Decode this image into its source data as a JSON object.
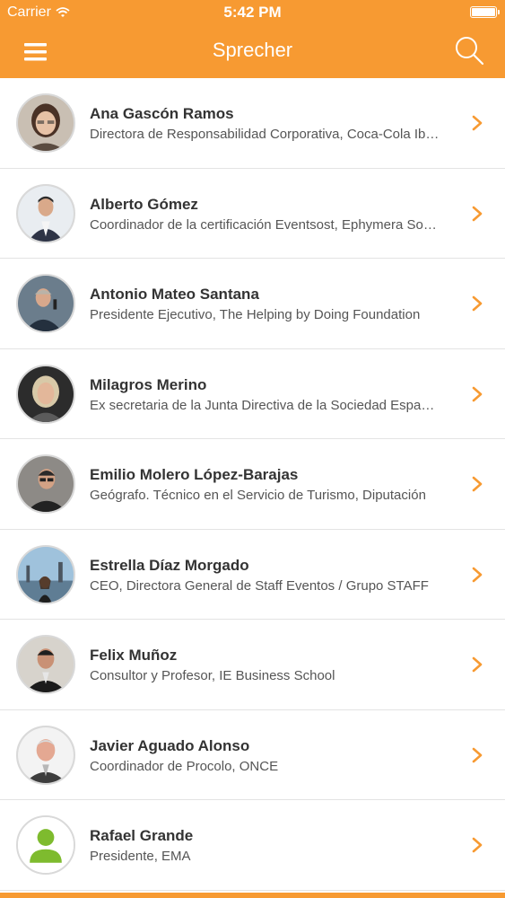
{
  "status_bar": {
    "carrier": "Carrier",
    "time": "5:42 PM"
  },
  "nav": {
    "title": "Sprecher",
    "menu_icon": "hamburger-icon",
    "search_icon": "search-icon"
  },
  "colors": {
    "accent": "#f79a32",
    "chevron": "#f79a32",
    "divider": "#e3e3e3"
  },
  "speakers": [
    {
      "name": "Ana Gascón Ramos",
      "role": "Directora de Responsabilidad Corporativa, Coca-Cola Iberia"
    },
    {
      "name": "Alberto Gómez",
      "role": "Coordinador de la certificación Eventsost, Ephymera Sostenibilidad"
    },
    {
      "name": "Antonio Mateo Santana",
      "role": "Presidente Ejecutivo, The Helping by Doing Foundation"
    },
    {
      "name": "Milagros Merino",
      "role": "Ex secretaria de la Junta Directiva de la Sociedad Española"
    },
    {
      "name": "Emilio Molero López-Barajas",
      "role": "Geógrafo. Técnico en el Servicio de Turismo, Diputación"
    },
    {
      "name": "Estrella Díaz Morgado",
      "role": "CEO, Directora General de Staff Eventos / Grupo STAFF"
    },
    {
      "name": "Felix Muñoz",
      "role": "Consultor y Profesor, IE Business School"
    },
    {
      "name": "Javier Aguado Alonso",
      "role": "Coordinador de Procolo, ONCE"
    },
    {
      "name": "Rafael Grande",
      "role": "Presidente, EMA"
    }
  ]
}
